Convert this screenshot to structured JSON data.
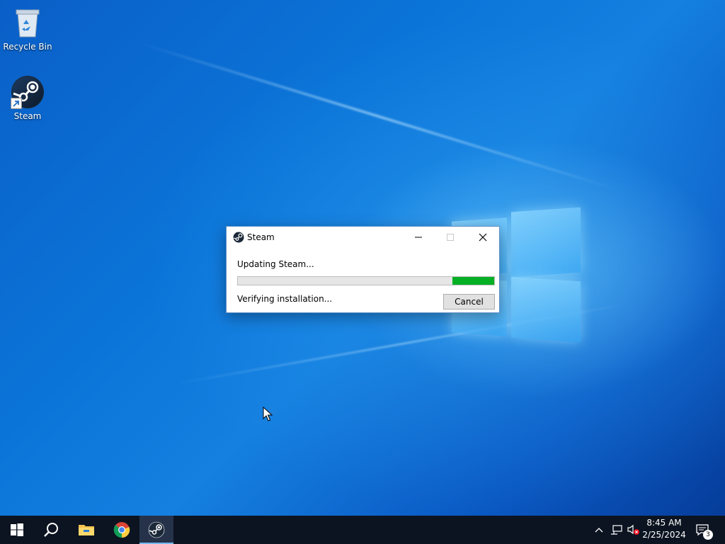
{
  "desktop": {
    "icons": [
      {
        "label": "Recycle Bin",
        "icon": "recycle-bin-icon"
      },
      {
        "label": "Steam",
        "icon": "steam-icon"
      }
    ]
  },
  "dialog": {
    "title": "Steam",
    "icon": "steam-icon",
    "status_line": "Updating Steam...",
    "progress": {
      "fill_start_fraction": 0.836,
      "fill_end_fraction": 1.0,
      "color": "#06b025"
    },
    "detail_line": "Verifying installation...",
    "cancel_label": "Cancel",
    "window_buttons": [
      "minimize",
      "maximize",
      "close"
    ]
  },
  "taskbar": {
    "items": [
      {
        "name": "start",
        "icon": "windows-start-icon"
      },
      {
        "name": "search",
        "icon": "search-icon"
      },
      {
        "name": "file-explorer",
        "icon": "folder-icon"
      },
      {
        "name": "chrome",
        "icon": "chrome-icon"
      },
      {
        "name": "steam",
        "icon": "steam-icon",
        "active": true
      }
    ],
    "tray": {
      "icons": [
        "chevron-up-icon",
        "network-icon",
        "volume-muted-icon"
      ],
      "time": "8:45 AM",
      "date": "2/25/2024",
      "notification_count": "3"
    }
  },
  "colors": {
    "accent": "#0078d7",
    "taskbar": "#0c1421",
    "progress_green": "#06b025"
  }
}
